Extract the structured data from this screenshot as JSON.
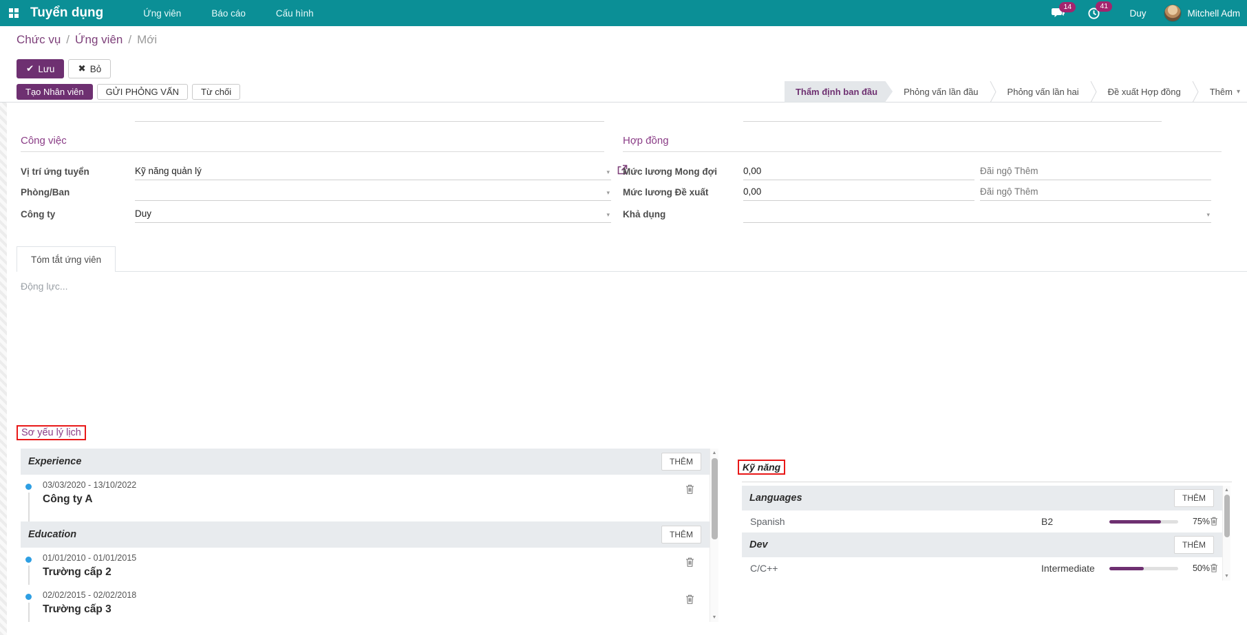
{
  "icons": {
    "check": "✔",
    "close": "✖",
    "caret": "▾",
    "up": "▲",
    "down": "▼",
    "slash": "/"
  },
  "labels": {
    "add": "THÊM"
  },
  "navbar": {
    "app_name": "Tuyển dụng",
    "menus": [
      {
        "label": "Ứng viên"
      },
      {
        "label": "Báo cáo"
      },
      {
        "label": "Cấu hình"
      }
    ],
    "messages_count": "14",
    "activities_count": "41",
    "company": "Duy",
    "user": "Mitchell Adm"
  },
  "breadcrumb": {
    "items": [
      "Chức vụ",
      "Ứng viên",
      "Mới"
    ]
  },
  "actions": {
    "save_label": "Lưu",
    "discard_label": "Bỏ"
  },
  "statusbar": {
    "buttons": [
      {
        "label": "Tạo Nhân viên"
      },
      {
        "label": "GỬI PHỎNG VẤN"
      },
      {
        "label": "Từ chối"
      }
    ],
    "stages": [
      {
        "label": "Thẩm định ban đầu"
      },
      {
        "label": "Phỏng vấn lần đầu"
      },
      {
        "label": "Phỏng vấn lần hai"
      },
      {
        "label": "Đề xuất Hợp đồng"
      },
      {
        "label": "Thêm"
      }
    ]
  },
  "form": {
    "job": {
      "title": "Công việc",
      "fields": [
        {
          "label": "Vị trí ứng tuyển",
          "value": "Kỹ năng quản lý"
        },
        {
          "label": "Phòng/Ban",
          "value": ""
        },
        {
          "label": "Công ty",
          "value": "Duy"
        }
      ]
    },
    "contract": {
      "title": "Hợp đồng",
      "fields": [
        {
          "label": "Mức lương Mong đợi",
          "value": "0,00",
          "placeholder": "Đãi ngộ Thêm"
        },
        {
          "label": "Mức lương Đề xuất",
          "value": "0,00",
          "placeholder": "Đãi ngộ Thêm"
        },
        {
          "label": "Khả dụng",
          "value": ""
        }
      ]
    },
    "tab_label": "Tóm tắt ứng viên",
    "summary_placeholder": "Động lực..."
  },
  "resume": {
    "title": "Sơ yếu lý lịch",
    "groups": [
      {
        "name": "Experience",
        "entries": [
          {
            "dates": "03/03/2020 - 13/10/2022",
            "title": "Công ty A"
          }
        ]
      },
      {
        "name": "Education",
        "entries": [
          {
            "dates": "01/01/2010 - 01/01/2015",
            "title": "Trường cấp 2"
          },
          {
            "dates": "02/02/2015 - 02/02/2018",
            "title": "Trường cấp 3"
          }
        ]
      }
    ]
  },
  "skills": {
    "title": "Kỹ năng",
    "groups": [
      {
        "name": "Languages",
        "rows": [
          {
            "skill": "Spanish",
            "level": "B2",
            "progress": 75,
            "progress_label": "75%"
          }
        ]
      },
      {
        "name": "Dev",
        "rows": [
          {
            "skill": "C/C++",
            "level": "Intermediate",
            "progress": 50,
            "progress_label": "50%"
          }
        ]
      }
    ]
  },
  "colors": {
    "navbar": "#0b8f96",
    "accent": "#6e3071",
    "badge": "#a3246e",
    "highlight": "#e81717",
    "timeline_dot": "#2e9fe3"
  }
}
